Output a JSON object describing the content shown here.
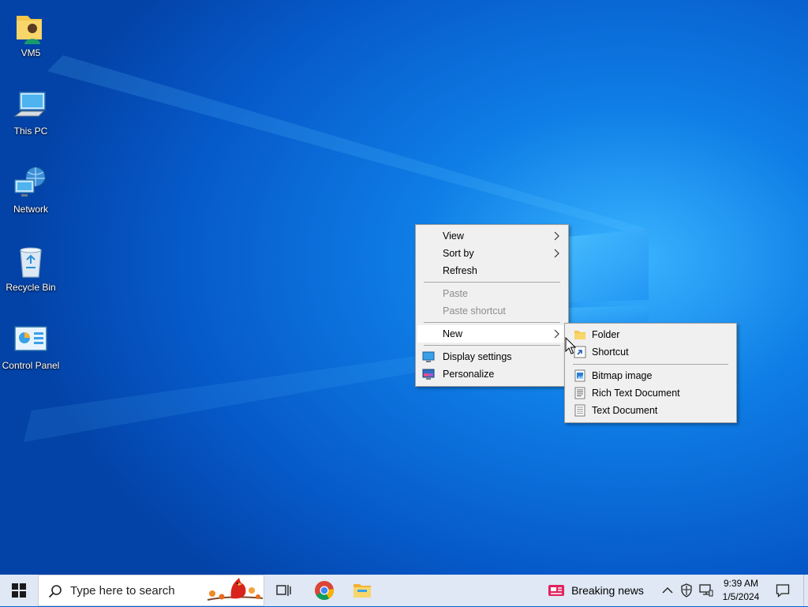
{
  "desktop": {
    "icons": [
      {
        "label": "VM5",
        "icon": "user-folder-icon"
      },
      {
        "label": "This PC",
        "icon": "computer-icon"
      },
      {
        "label": "Network",
        "icon": "network-icon"
      },
      {
        "label": "Recycle Bin",
        "icon": "recycle-bin-icon"
      },
      {
        "label": "Control Panel",
        "icon": "control-panel-icon"
      }
    ]
  },
  "context_menu": {
    "items": [
      {
        "label": "View",
        "has_submenu": true,
        "enabled": true
      },
      {
        "label": "Sort by",
        "has_submenu": true,
        "enabled": true
      },
      {
        "label": "Refresh",
        "enabled": true
      },
      {
        "label": "Paste",
        "enabled": false
      },
      {
        "label": "Paste shortcut",
        "enabled": false
      },
      {
        "label": "New",
        "has_submenu": true,
        "enabled": true,
        "highlighted": true
      },
      {
        "label": "Display settings",
        "icon": "display-settings-icon",
        "enabled": true
      },
      {
        "label": "Personalize",
        "icon": "personalize-icon",
        "enabled": true
      }
    ]
  },
  "new_submenu": {
    "items": [
      {
        "label": "Folder",
        "icon": "folder-icon"
      },
      {
        "label": "Shortcut",
        "icon": "shortcut-icon"
      },
      {
        "label": "Bitmap image",
        "icon": "bitmap-icon"
      },
      {
        "label": "Rich Text Document",
        "icon": "rich-text-icon"
      },
      {
        "label": "Text Document",
        "icon": "text-document-icon"
      }
    ]
  },
  "taskbar": {
    "search_placeholder": "Type here to search",
    "news_label": "Breaking news",
    "clock_time": "9:39 AM",
    "clock_date": "1/5/2024"
  },
  "colors": {
    "wallpaper": "#0a63d6",
    "taskbar": "#dfe8f4",
    "menu_bg": "#f0f0f0",
    "menu_hover": "#ffffff",
    "disabled_text": "#8d8d8d"
  }
}
